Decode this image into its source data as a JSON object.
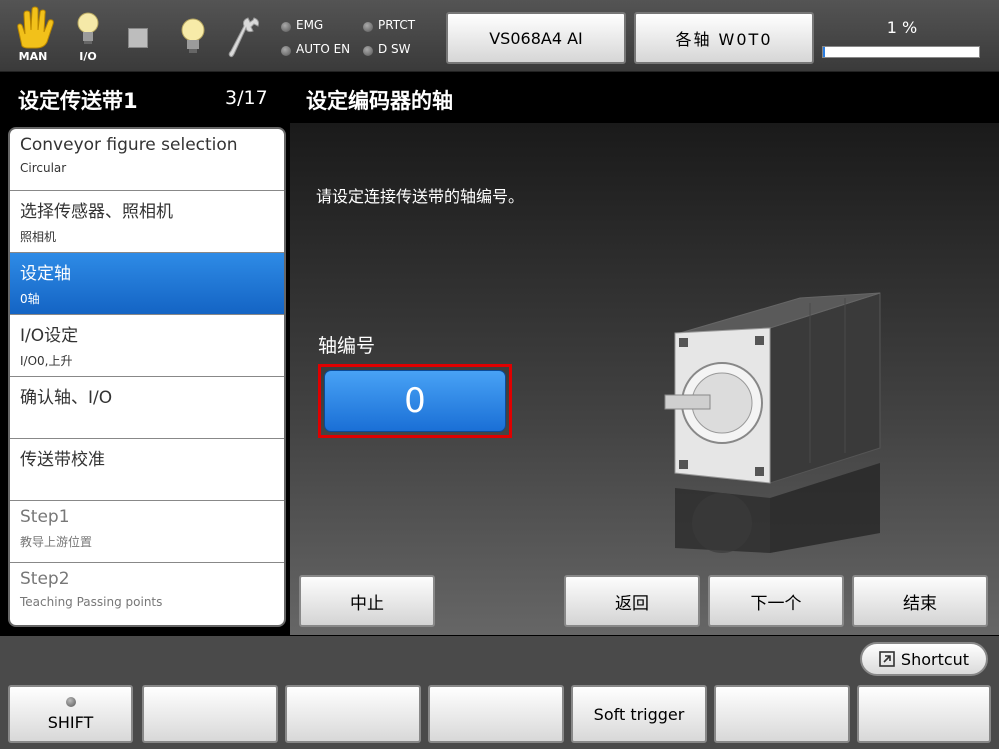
{
  "top": {
    "man_label": "MAN",
    "io_label": "I/O",
    "lamps": [
      {
        "label": "EMG"
      },
      {
        "label": "PRTCT"
      },
      {
        "label": "AUTO EN"
      },
      {
        "label": "D SW"
      }
    ],
    "robot_button": "VS068A4 AI",
    "axis_button": "各轴 W0T0",
    "speed_label": "1 %",
    "speed_fraction": 0.01
  },
  "header": {
    "title": "设定传送带1",
    "page": "3/17",
    "content_title": "设定编码器的轴"
  },
  "steps": [
    {
      "main": "Conveyor figure selection",
      "sub": "Circular",
      "state": "normal"
    },
    {
      "main": "选择传感器、照相机",
      "sub": "照相机",
      "state": "normal"
    },
    {
      "main": "设定轴",
      "sub": "0轴",
      "state": "active"
    },
    {
      "main": "I/O设定",
      "sub": "I/O0,上升",
      "state": "normal"
    },
    {
      "main": "确认轴、I/O",
      "sub": "",
      "state": "normal"
    },
    {
      "main": "传送带校准",
      "sub": "",
      "state": "normal"
    },
    {
      "main": "Step1",
      "sub": "教导上游位置",
      "state": "dim"
    },
    {
      "main": "Step2",
      "sub": "Teaching Passing points",
      "state": "dim"
    }
  ],
  "content": {
    "instruction": "请设定连接传送带的轴编号。",
    "axis_label": "轴编号",
    "axis_value": "0"
  },
  "nav": {
    "cancel": "中止",
    "back": "返回",
    "next": "下一个",
    "finish": "结束"
  },
  "shortcut_label": "Shortcut",
  "fkeys": [
    "SHIFT",
    "",
    "",
    "",
    "Soft trigger",
    "",
    ""
  ],
  "colors": {
    "accent": "#1a6fd6",
    "highlight": "#e00000"
  }
}
